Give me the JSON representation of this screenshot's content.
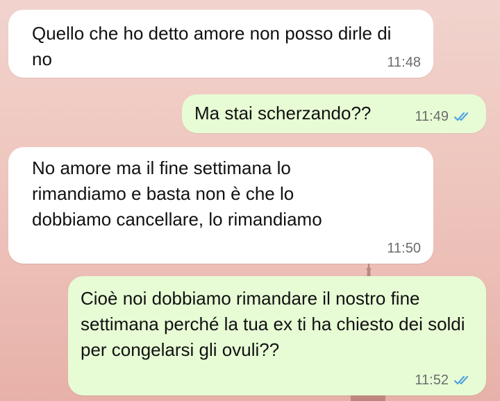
{
  "messages": [
    {
      "direction": "incoming",
      "text": "Quello che ho detto amore non posso dirle di no",
      "time": "11:48"
    },
    {
      "direction": "outgoing",
      "text": "Ma stai scherzando??",
      "time": "11:49",
      "status": "read"
    },
    {
      "direction": "incoming",
      "text": "No amore ma il fine settimana lo rimandiamo e basta non è che lo dobbiamo cancellare, lo rimandiamo",
      "time": "11:50"
    },
    {
      "direction": "outgoing",
      "text": "Cioè noi dobbiamo rimandare il nostro fine settimana perché la tua ex ti ha chiesto dei soldi per congelarsi gli ovuli??",
      "time": "11:52",
      "status": "read"
    }
  ],
  "colors": {
    "incoming_bubble": "#ffffff",
    "outgoing_bubble": "#e7fcd5",
    "read_ticks": "#4fa3e0",
    "timestamp": "#6b6b6b"
  },
  "icons": {
    "read_receipt": "double-check-icon"
  }
}
